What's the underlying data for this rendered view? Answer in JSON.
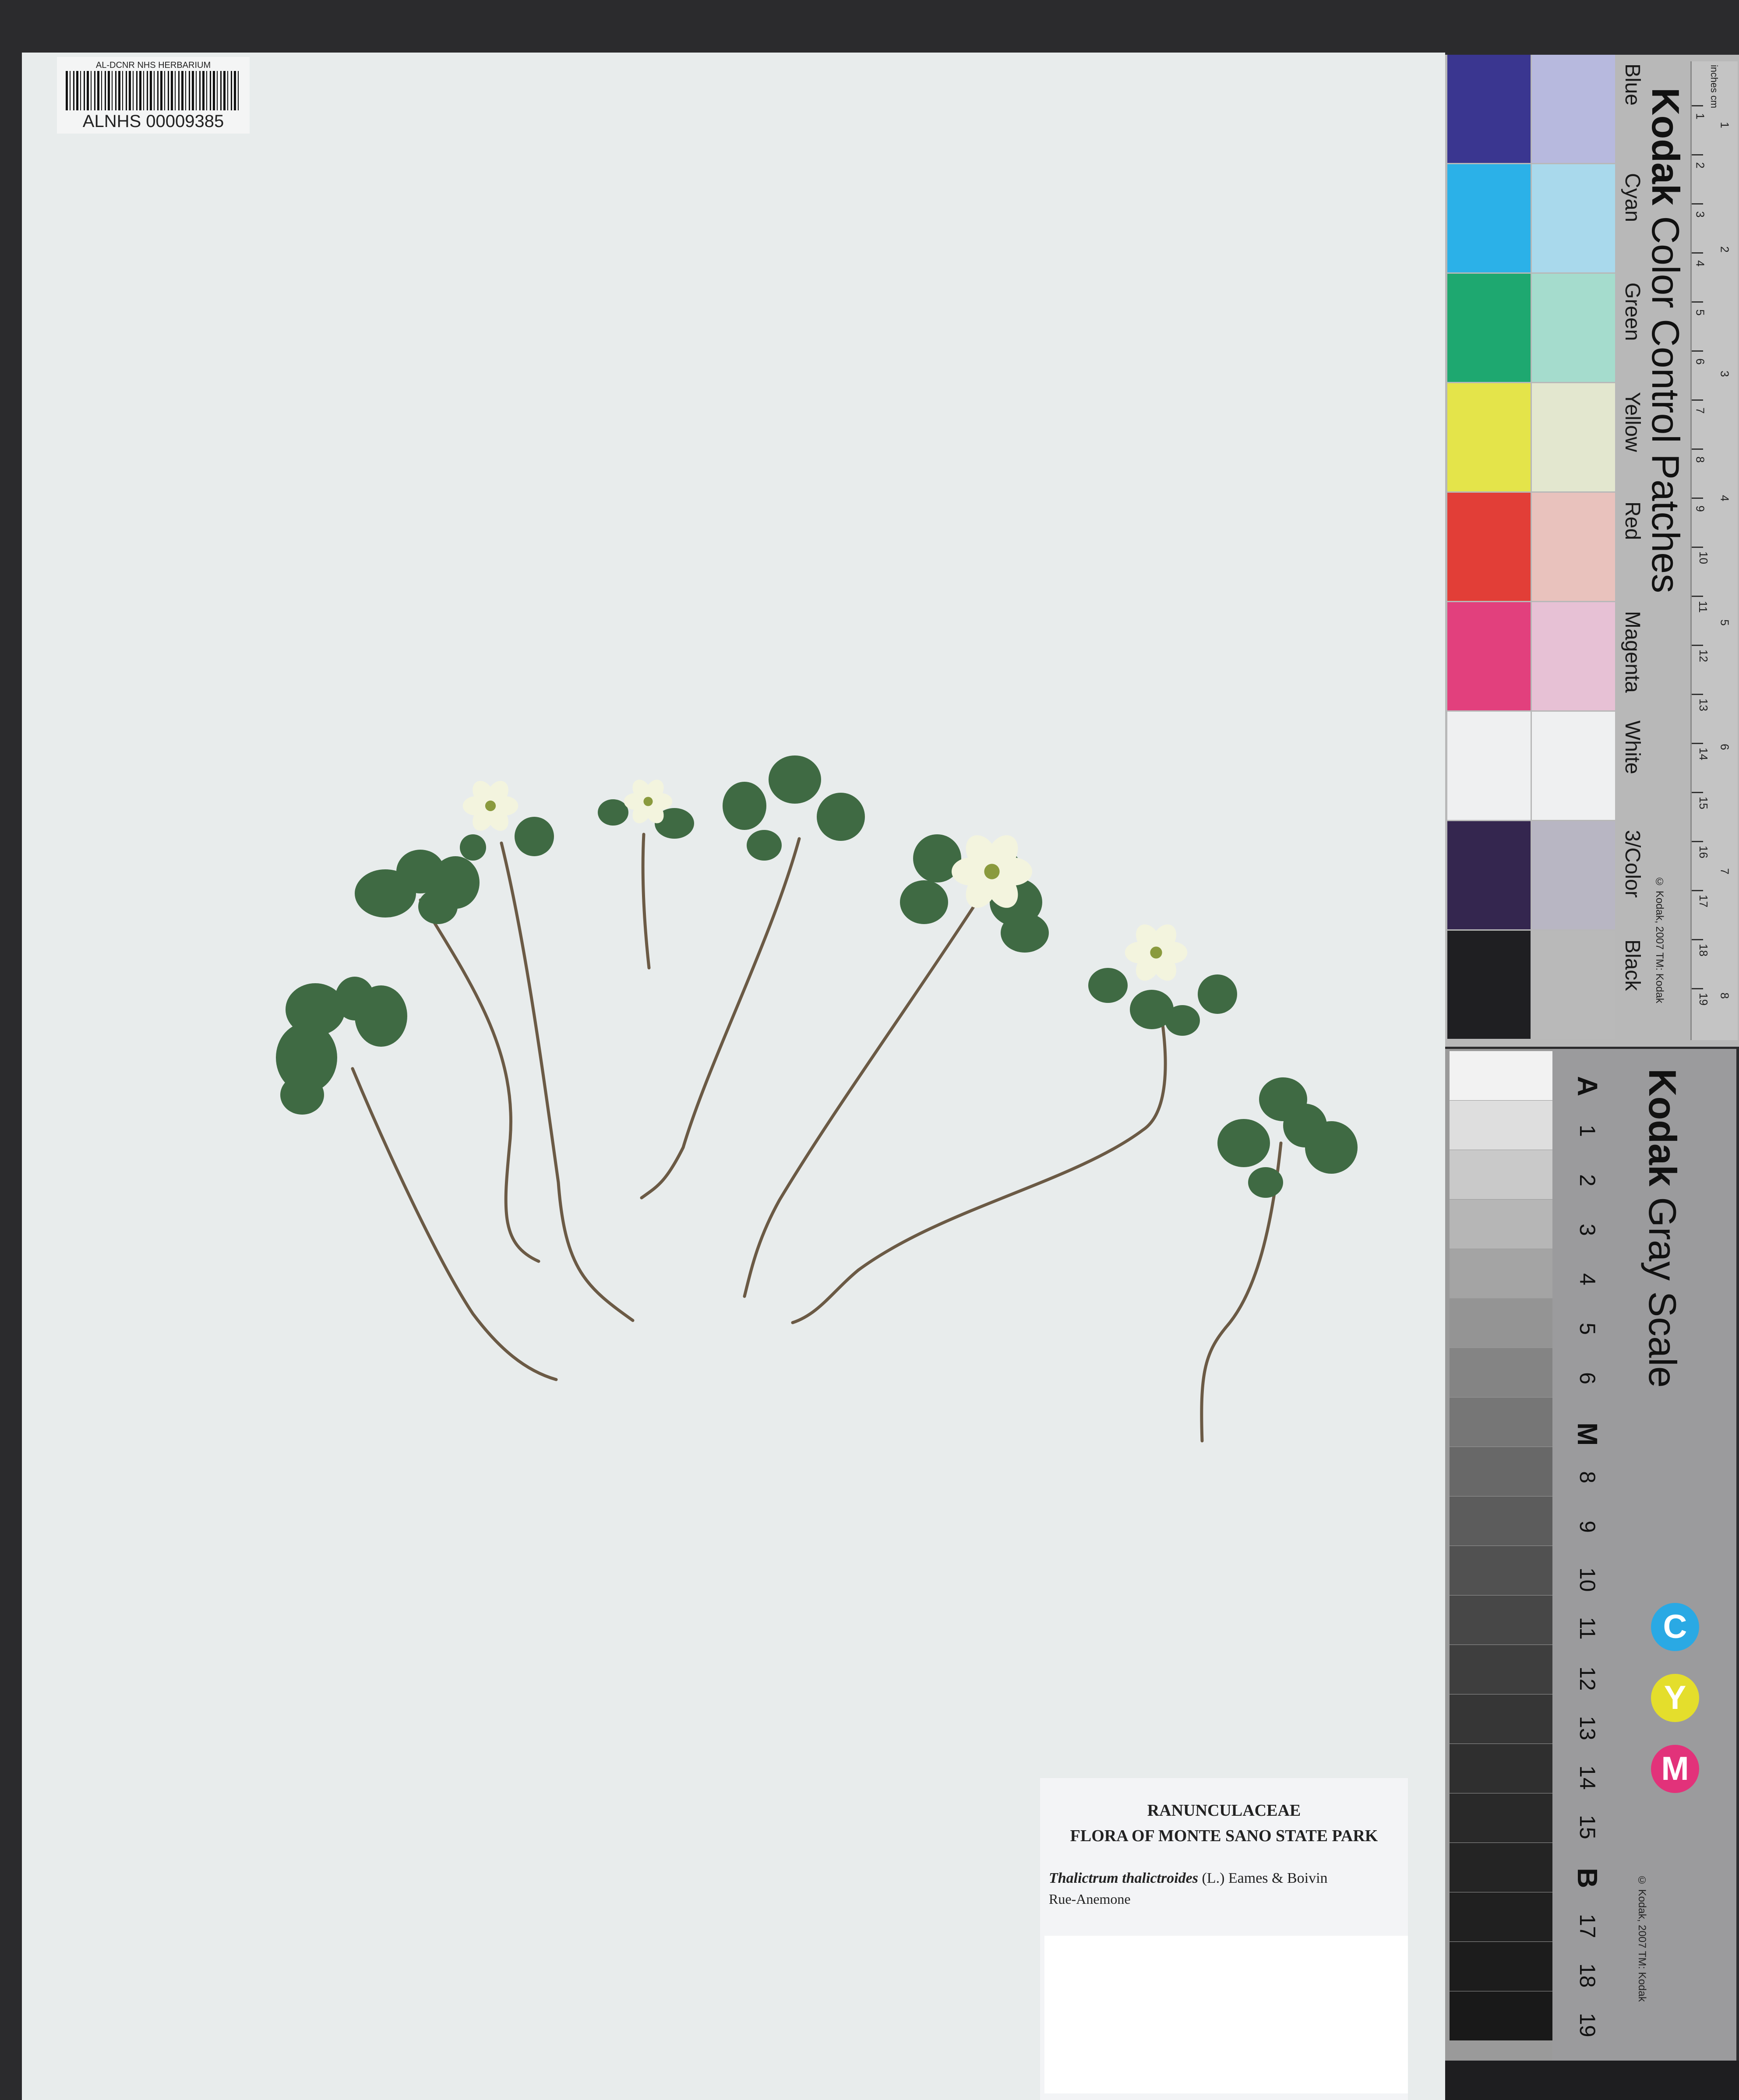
{
  "herbarium_sheet": {
    "barcode_header": "AL-DCNR NHS HERBARIUM",
    "barcode_number": "ALNHS 00009385"
  },
  "label": {
    "family": "RANUNCULACEAE",
    "flora": "FLORA OF MONTE SANO STATE PARK",
    "scientific_name": "Thalictrum thalictroides",
    "authority": "(L.) Eames & Boivin",
    "common_name": "Rue-Anemone"
  },
  "color_card": {
    "title_bold": "Kodak",
    "title_rest": " Color Control Patches",
    "patches": [
      {
        "name": "Blue",
        "dark": "#3a3690",
        "light": "#b7b9de"
      },
      {
        "name": "Cyan",
        "dark": "#2bb1e8",
        "light": "#a9d9ec"
      },
      {
        "name": "Green",
        "dark": "#1ea870",
        "light": "#a5dccd"
      },
      {
        "name": "Yellow",
        "dark": "#e4e44a",
        "light": "#e3e7cf"
      },
      {
        "name": "Red",
        "dark": "#e23e37",
        "light": "#e9c2bd"
      },
      {
        "name": "Magenta",
        "dark": "#e2407d",
        "light": "#e7c1d5"
      },
      {
        "name": "White",
        "dark": "#eff0f1",
        "light": "#eff0f1"
      },
      {
        "name": "3/Color",
        "dark": "#34264f",
        "light": "#b8b6c3"
      },
      {
        "name": "Black",
        "dark": "#1f1f22",
        "light": "#b9b9b9"
      }
    ],
    "copyright": "© Kodak, 2007 TM: Kodak",
    "ruler_units": [
      "inches",
      "cm"
    ],
    "ruler_cm": [
      "1",
      "2",
      "3",
      "4",
      "5",
      "6",
      "7",
      "8",
      "9",
      "10",
      "11",
      "12",
      "13",
      "14",
      "15",
      "16",
      "17",
      "18",
      "19"
    ],
    "ruler_inches": [
      "1",
      "2",
      "3",
      "4",
      "5",
      "6",
      "7",
      "8"
    ]
  },
  "gray_card": {
    "title_bold": "Kodak",
    "title_rest": " Gray Scale",
    "steps": [
      "A",
      "1",
      "2",
      "3",
      "4",
      "5",
      "6",
      "M",
      "8",
      "9",
      "10",
      "11",
      "12",
      "13",
      "14",
      "15",
      "B",
      "17",
      "18",
      "19"
    ],
    "shades": [
      "#f2f2f2",
      "#dedede",
      "#c9c9c9",
      "#b6b6b6",
      "#a4a4a4",
      "#949494",
      "#848484",
      "#767676",
      "#686868",
      "#5c5c5c",
      "#515151",
      "#474747",
      "#3e3e3e",
      "#363636",
      "#2f2f2f",
      "#292929",
      "#242424",
      "#202020",
      "#1c1c1c",
      "#191919"
    ],
    "cym": [
      {
        "letter": "C",
        "color": "#2aa9e4"
      },
      {
        "letter": "Y",
        "color": "#e4de2c"
      },
      {
        "letter": "M",
        "color": "#e2327a"
      }
    ],
    "copyright": "© Kodak, 2007 TM: Kodak"
  },
  "specimen": {
    "leaf_color": "#3f6a43",
    "stem_color": "#6b5a45",
    "flower_color": "#f3f4de"
  }
}
